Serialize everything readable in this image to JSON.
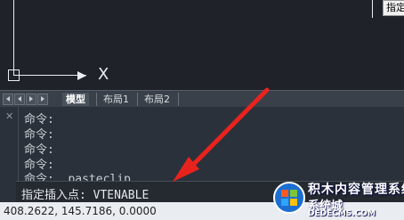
{
  "canvas": {
    "axis_x_label": "X",
    "tooltip_label": "指定"
  },
  "tabs": {
    "items": [
      {
        "label": "模型",
        "active": true
      },
      {
        "label": "布局1",
        "active": false
      },
      {
        "label": "布局2",
        "active": false
      }
    ]
  },
  "command": {
    "close_label": "✕",
    "lines": [
      "命令:",
      "命令:",
      "命令:",
      "命令:",
      "命令: _pasteclip"
    ],
    "prompt": "指定插入点: VTENABLE"
  },
  "status": {
    "coordinates": "408.2622, 145.7186, 0.0000"
  },
  "watermark": {
    "main": "积木内容管理系统",
    "sub": "系统城",
    "url": "DEDECMS.COM"
  },
  "colors": {
    "annotation_arrow": "#e8231e",
    "canvas_bg": "#1f2329",
    "command_bg": "#2b313a",
    "status_bg": "#e9edf1"
  }
}
